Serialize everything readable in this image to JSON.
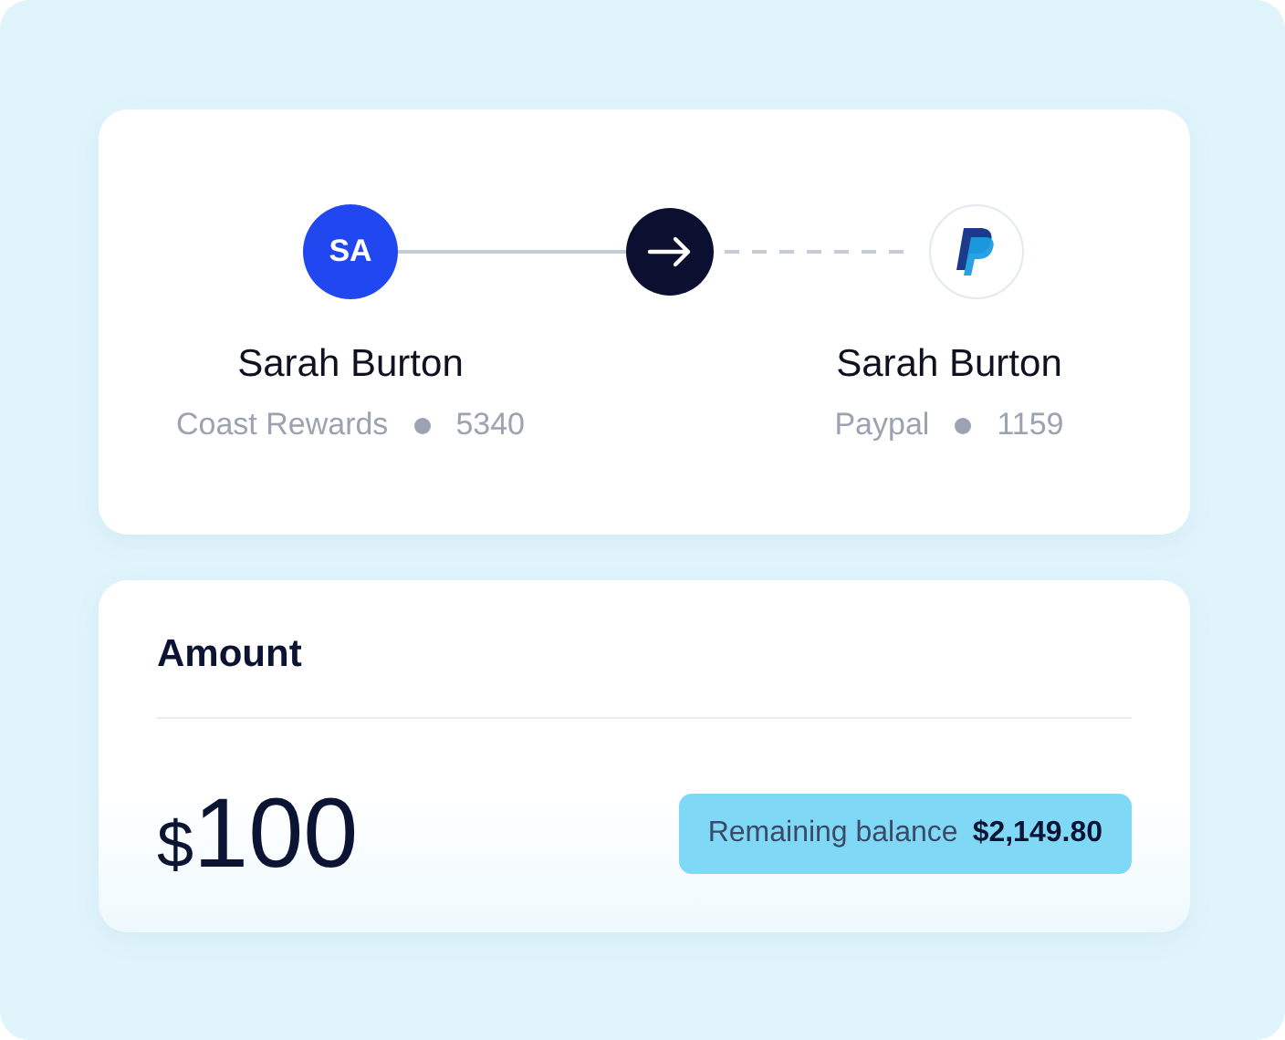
{
  "sender": {
    "initials": "SA",
    "name": "Sarah Burton",
    "account": "Coast Rewards",
    "last4": "5340"
  },
  "recipient": {
    "name": "Sarah Burton",
    "account": "Paypal",
    "last4": "1159"
  },
  "amount": {
    "label": "Amount",
    "currency": "$",
    "value": "100"
  },
  "balance": {
    "label": "Remaining balance",
    "value": "$2,149.80"
  }
}
